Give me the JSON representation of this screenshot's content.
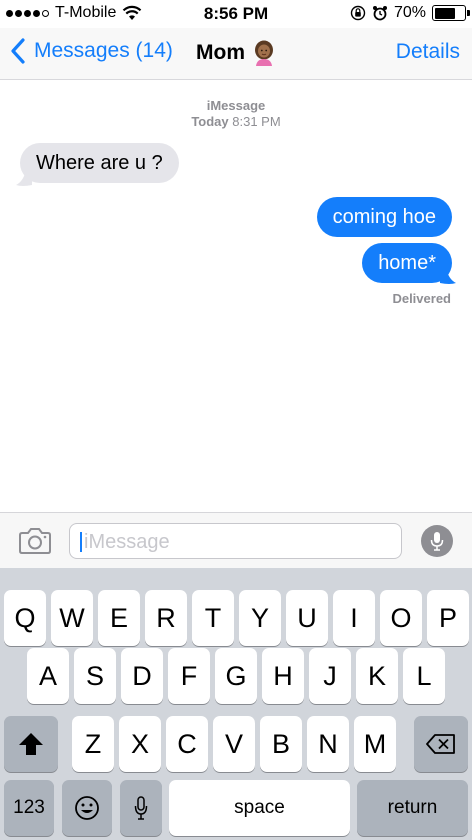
{
  "status_bar": {
    "carrier": "T-Mobile",
    "time": "8:56 PM",
    "battery_percent": "70%",
    "battery_level": 0.7,
    "icons": [
      "signal-dots",
      "wifi-icon",
      "orientation-lock-icon",
      "alarm-icon",
      "battery-icon"
    ]
  },
  "nav": {
    "back_label": "Messages (14)",
    "title": "Mom",
    "title_emoji": "woman-emoji",
    "details_label": "Details"
  },
  "thread": {
    "service": "iMessage",
    "date_label": "Today",
    "time_label": "8:31 PM",
    "messages": [
      {
        "direction": "in",
        "text": "Where are u ?"
      },
      {
        "direction": "out",
        "text": "coming hoe"
      },
      {
        "direction": "out",
        "text": "home*"
      }
    ],
    "status": "Delivered"
  },
  "composer": {
    "placeholder": "iMessage",
    "value": ""
  },
  "keyboard": {
    "row1": [
      "Q",
      "W",
      "E",
      "R",
      "T",
      "Y",
      "U",
      "I",
      "O",
      "P"
    ],
    "row2": [
      "A",
      "S",
      "D",
      "F",
      "G",
      "H",
      "J",
      "K",
      "L"
    ],
    "row3": [
      "Z",
      "X",
      "C",
      "V",
      "B",
      "N",
      "M"
    ],
    "numbers_label": "123",
    "space_label": "space",
    "return_label": "return"
  },
  "colors": {
    "accent": "#147efb",
    "incoming_bubble": "#e5e5ea",
    "keyboard_bg": "#d1d5db"
  }
}
